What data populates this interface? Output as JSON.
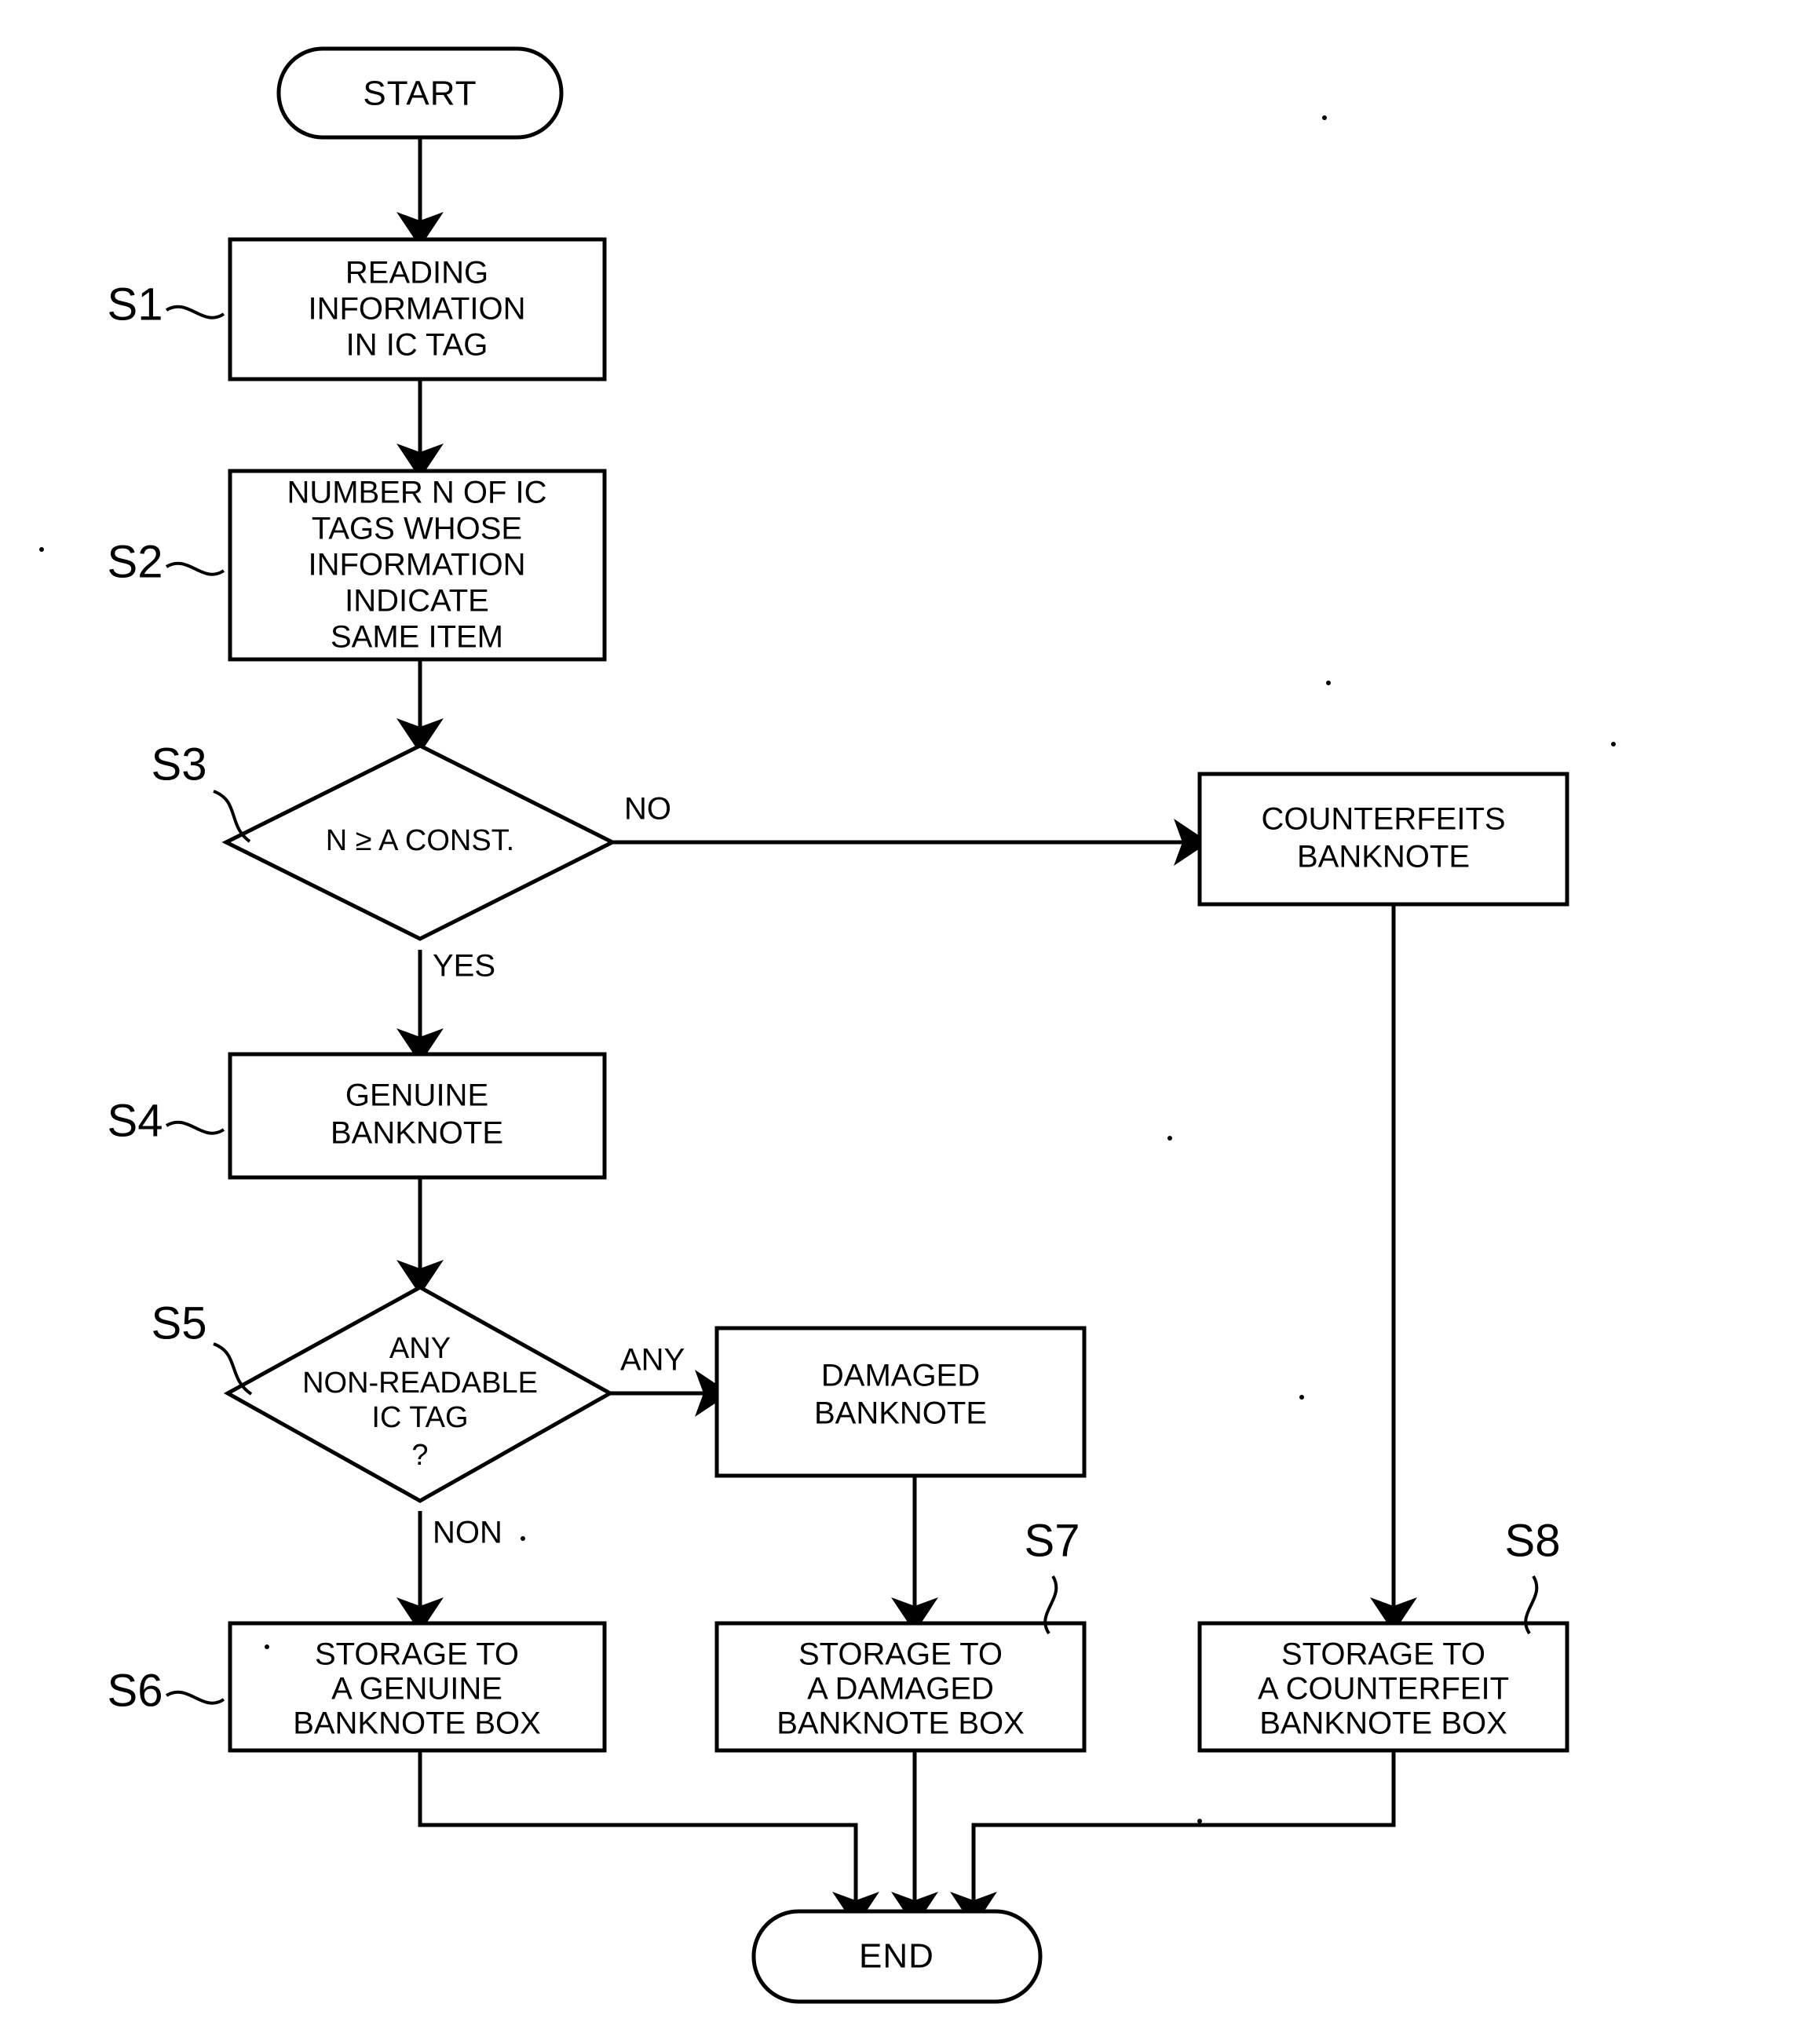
{
  "figure": {
    "kind": "flowchart",
    "orientation": "top-to-bottom",
    "line_color": "#000000",
    "background_color": "#ffffff"
  },
  "nodes": {
    "start": {
      "shape": "terminator",
      "label": "START"
    },
    "s1": {
      "shape": "process",
      "step": "S1",
      "lines": [
        "READING",
        "INFORMATION",
        "IN IC TAG"
      ]
    },
    "s2": {
      "shape": "process",
      "step": "S2",
      "lines": [
        "NUMBER N OF IC",
        "TAGS WHOSE",
        "INFORMATION",
        "INDICATE",
        "SAME ITEM"
      ]
    },
    "s3": {
      "shape": "decision",
      "step": "S3",
      "lines": [
        "N ≥ A CONST."
      ]
    },
    "counterfeits": {
      "shape": "process",
      "step": "",
      "lines": [
        "COUNTERFEITS",
        "BANKNOTE"
      ]
    },
    "s4": {
      "shape": "process",
      "step": "S4",
      "lines": [
        "GENUINE",
        "BANKNOTE"
      ]
    },
    "s5": {
      "shape": "decision",
      "step": "S5",
      "lines": [
        "ANY",
        "NON-READABLE",
        "IC TAG",
        "?"
      ]
    },
    "damaged": {
      "shape": "process",
      "step": "",
      "lines": [
        "DAMAGED",
        "BANKNOTE"
      ]
    },
    "s6": {
      "shape": "process",
      "step": "S6",
      "lines": [
        "STORAGE TO",
        "A GENUINE",
        "BANKNOTE BOX"
      ]
    },
    "s7": {
      "shape": "process",
      "step": "S7",
      "lines": [
        "STORAGE TO",
        "A DAMAGED",
        "BANKNOTE BOX"
      ]
    },
    "s8": {
      "shape": "process",
      "step": "S8",
      "lines": [
        "STORAGE TO",
        "A COUNTERFEIT",
        "BANKNOTE BOX"
      ]
    },
    "end": {
      "shape": "terminator",
      "label": "END"
    }
  },
  "edge_labels": {
    "s3_no": "NO",
    "s3_yes": "YES",
    "s5_any": "ANY",
    "s5_non": "NON"
  },
  "step_labels": {
    "s1": "S1",
    "s2": "S2",
    "s3": "S3",
    "s4": "S4",
    "s5": "S5",
    "s6": "S6",
    "s7": "S7",
    "s8": "S8"
  }
}
